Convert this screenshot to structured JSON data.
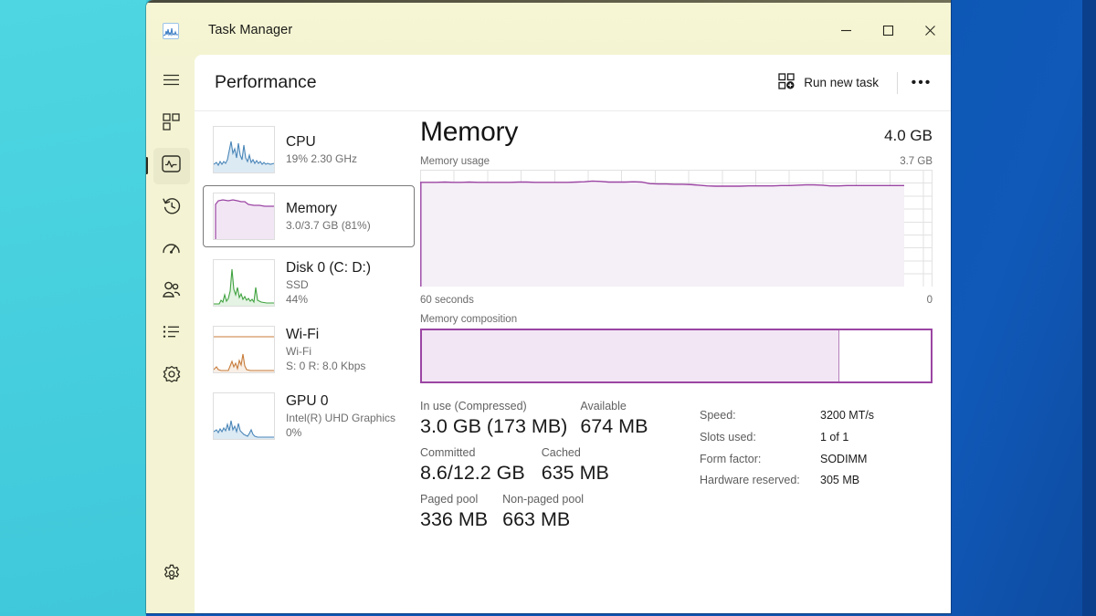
{
  "desktop": {
    "left_bg": "#45d0df",
    "right_bg": "#1059b8"
  },
  "window": {
    "title": "Task Manager",
    "app_icon": "task-manager-icon",
    "controls": {
      "minimize": "minimize-icon",
      "maximize": "maximize-icon",
      "close": "close-icon"
    }
  },
  "rail": {
    "items": [
      {
        "name": "hamburger",
        "icon": "hamburger-menu-icon",
        "selected": false
      },
      {
        "name": "processes",
        "icon": "processes-grid-icon",
        "selected": false
      },
      {
        "name": "performance",
        "icon": "performance-pulse-icon",
        "selected": true
      },
      {
        "name": "app-history",
        "icon": "history-clock-icon",
        "selected": false
      },
      {
        "name": "startup-apps",
        "icon": "startup-gauge-icon",
        "selected": false
      },
      {
        "name": "users",
        "icon": "users-people-icon",
        "selected": false
      },
      {
        "name": "details",
        "icon": "details-list-icon",
        "selected": false
      },
      {
        "name": "services",
        "icon": "services-cog-icon",
        "selected": false
      }
    ],
    "settings": {
      "name": "settings",
      "icon": "settings-gear-icon"
    }
  },
  "page": {
    "title": "Performance",
    "run_new_task": "Run new task",
    "run_new_task_icon": "new-task-icon",
    "more_options": "•••"
  },
  "devices": [
    {
      "name": "CPU",
      "sub1": "19%  2.30 GHz",
      "sub2": "",
      "selected": false,
      "color": "#4a86b8",
      "fill": "#dceaf4",
      "graph": "cpu-thumbnail-graph"
    },
    {
      "name": "Memory",
      "sub1": "3.0/3.7 GB (81%)",
      "sub2": "",
      "selected": true,
      "color": "#9b45a3",
      "fill": "#f2e6f4",
      "graph": "memory-thumbnail-graph"
    },
    {
      "name": "Disk 0 (C: D:)",
      "sub1": "SSD",
      "sub2": "44%",
      "selected": false,
      "color": "#3fa23f",
      "fill": "#e4f3e4",
      "graph": "disk-thumbnail-graph"
    },
    {
      "name": "Wi-Fi",
      "sub1": "Wi-Fi",
      "sub2": "S: 0 R: 8.0 Kbps",
      "selected": false,
      "color": "#c77b3a",
      "fill": "#f8efe6",
      "graph": "wifi-thumbnail-graph"
    },
    {
      "name": "GPU 0",
      "sub1": "Intel(R) UHD Graphics",
      "sub2": "0%",
      "selected": false,
      "color": "#4a86b8",
      "fill": "#dceaf4",
      "graph": "gpu-thumbnail-graph"
    }
  ],
  "detail": {
    "title": "Memory",
    "total": "4.0 GB",
    "usage_label": "Memory usage",
    "usage_max": "3.7 GB",
    "time_left": "60 seconds",
    "time_right": "0",
    "composition_label": "Memory composition",
    "composition_used_pct": 82,
    "accent": "#9b45a3",
    "stats": [
      [
        {
          "label": "In use (Compressed)",
          "value": "3.0 GB (173 MB)"
        },
        {
          "label": "Available",
          "value": "674 MB"
        }
      ],
      [
        {
          "label": "Committed",
          "value": "8.6/12.2 GB"
        },
        {
          "label": "Cached",
          "value": "635 MB"
        }
      ],
      [
        {
          "label": "Paged pool",
          "value": "336 MB"
        },
        {
          "label": "Non-paged pool",
          "value": "663 MB"
        }
      ]
    ],
    "specs": [
      {
        "key": "Speed:",
        "value": "3200 MT/s"
      },
      {
        "key": "Slots used:",
        "value": "1 of 1"
      },
      {
        "key": "Form factor:",
        "value": "SODIMM"
      },
      {
        "key": "Hardware reserved:",
        "value": "305 MB"
      }
    ]
  },
  "chart_data": {
    "type": "area",
    "title": "Memory usage",
    "xlabel": "",
    "ylabel": "",
    "ylim": [
      0,
      3.7
    ],
    "ytick_labels": [
      "3.7 GB",
      "0"
    ],
    "xtick_labels": [
      "60 seconds",
      "0"
    ],
    "grid": true,
    "units": "GB",
    "series": [
      {
        "name": "Memory in use",
        "color": "#9b45a3",
        "fill": "#f5eff7",
        "values": [
          3.3,
          3.3,
          3.3,
          3.31,
          3.3,
          3.3,
          3.31,
          3.3,
          3.3,
          3.3,
          3.3,
          3.3,
          3.31,
          3.31,
          3.3,
          3.3,
          3.3,
          3.3,
          3.3,
          3.31,
          3.32,
          3.34,
          3.33,
          3.31,
          3.31,
          3.31,
          3.32,
          3.31,
          3.26,
          3.25,
          3.25,
          3.24,
          3.24,
          3.23,
          3.21,
          3.19,
          3.18,
          3.18,
          3.18,
          3.18,
          3.19,
          3.19,
          3.19,
          3.19,
          3.2,
          3.2,
          3.21,
          3.22,
          3.22,
          3.21,
          3.19,
          3.19,
          3.2,
          3.2,
          3.2,
          3.2,
          3.2,
          3.2,
          3.2,
          3.2
        ]
      }
    ]
  }
}
